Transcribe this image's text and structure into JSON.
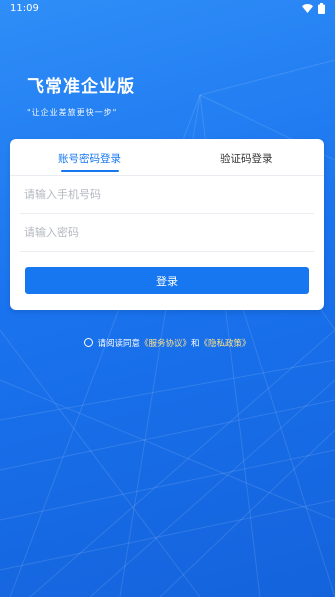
{
  "status_bar": {
    "time": "11:09",
    "icons": [
      "wifi-icon",
      "battery-icon"
    ]
  },
  "brand": {
    "title": "飞常准企业版",
    "slogan": "\"让企业差旅更快一步\""
  },
  "login_card": {
    "tabs": [
      {
        "label": "账号密码登录",
        "active": true
      },
      {
        "label": "验证码登录",
        "active": false
      }
    ],
    "phone_placeholder": "请输入手机号码",
    "password_placeholder": "请输入密码",
    "login_label": "登录"
  },
  "agreement": {
    "prefix": "请阅读同意",
    "service_link": "《服务协议》",
    "conjunction": "和",
    "privacy_link": "《隐私政策》"
  },
  "colors": {
    "primary": "#1677f0",
    "background": "#1a73ee",
    "link": "#ffe38a"
  }
}
